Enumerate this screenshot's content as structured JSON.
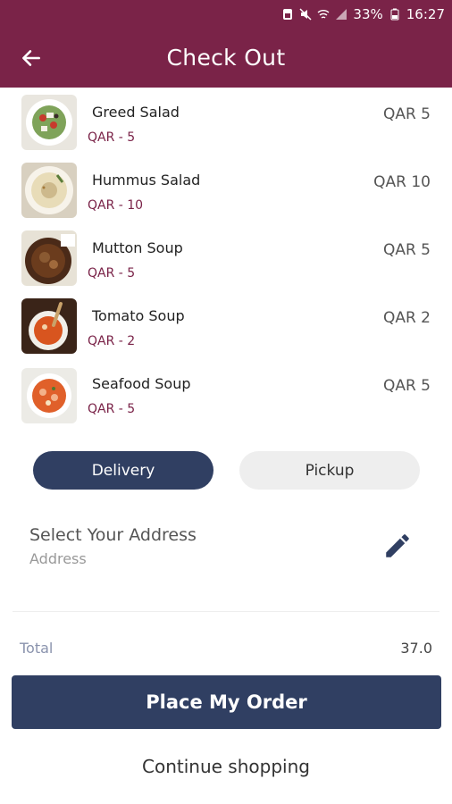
{
  "statusbar": {
    "battery": "33%",
    "time": "16:27"
  },
  "header": {
    "title": "Check Out"
  },
  "items": [
    {
      "name": "Greed Salad",
      "sub": "QAR - 5",
      "price": "QAR 5"
    },
    {
      "name": "Hummus Salad",
      "sub": "QAR - 10",
      "price": "QAR 10"
    },
    {
      "name": "Mutton Soup",
      "sub": "QAR - 5",
      "price": "QAR 5"
    },
    {
      "name": "Tomato Soup",
      "sub": "QAR - 2",
      "price": "QAR 2"
    },
    {
      "name": "Seafood Soup",
      "sub": "QAR - 5",
      "price": "QAR 5"
    }
  ],
  "options": {
    "delivery": "Delivery",
    "pickup": "Pickup"
  },
  "address": {
    "title": "Select Your Address",
    "placeholder": "Address"
  },
  "summary": {
    "total_label": "Total",
    "total_value": "37.0"
  },
  "actions": {
    "place_order": "Place My Order",
    "continue": "Continue shopping"
  },
  "colors": {
    "header": "#7a2348",
    "primary": "#303f62",
    "accent_text": "#7a2348"
  }
}
